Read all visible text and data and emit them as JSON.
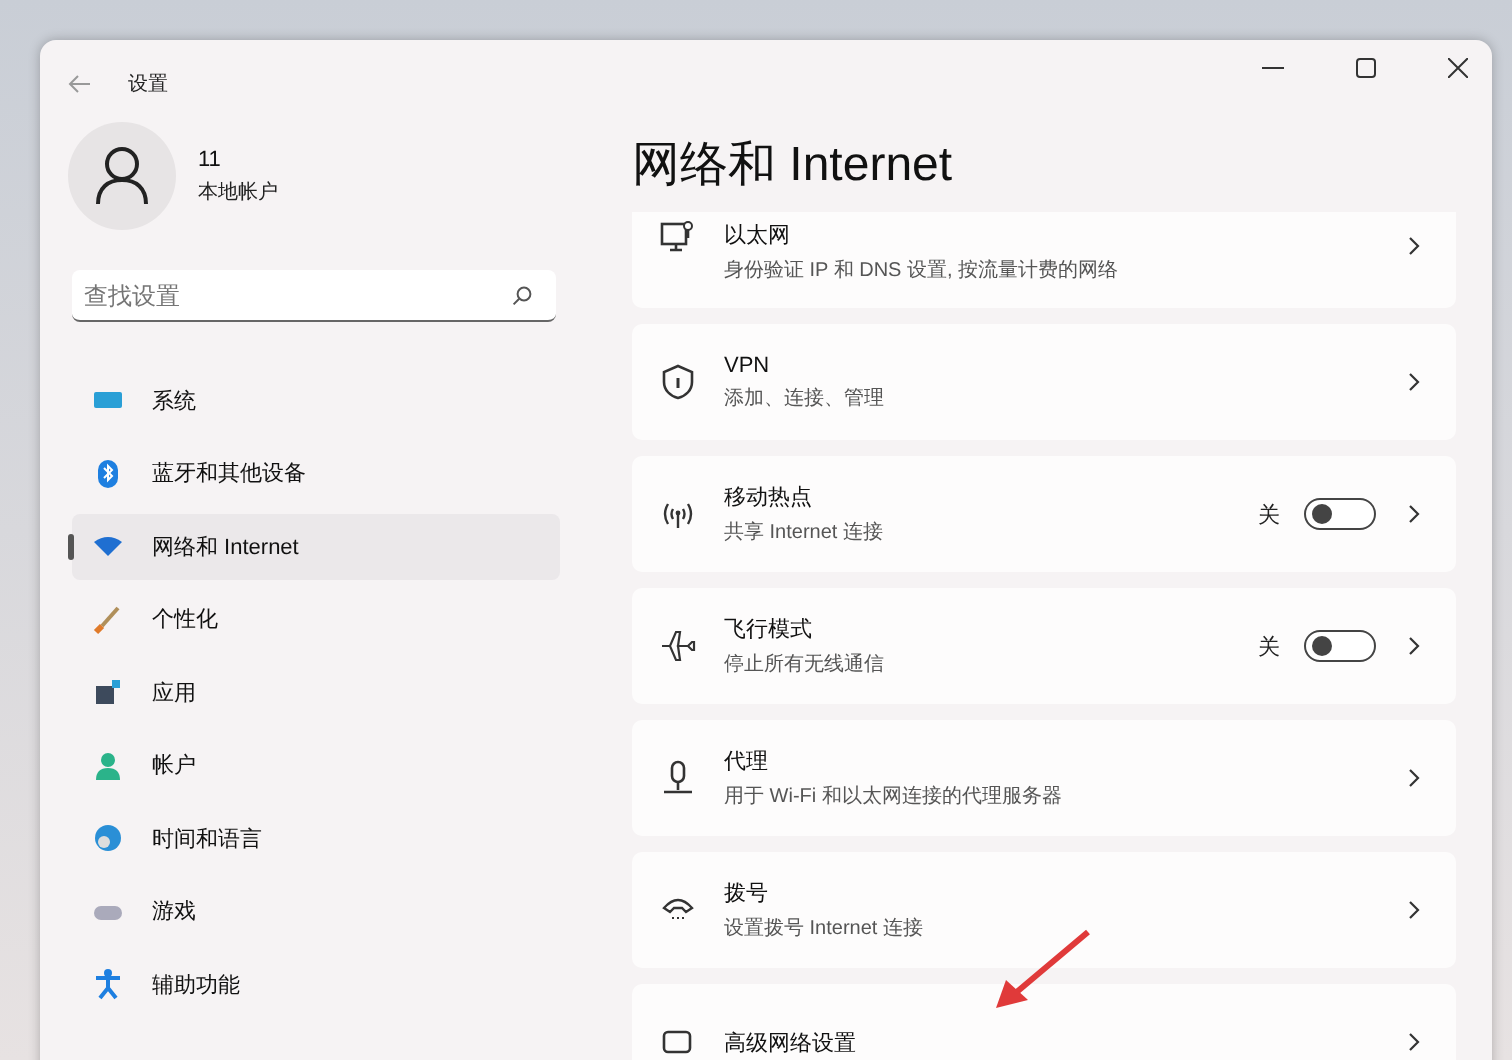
{
  "window": {
    "title": "设置"
  },
  "account": {
    "name": "11",
    "type": "本地帐户"
  },
  "search": {
    "placeholder": "查找设置"
  },
  "sidebar": {
    "items": [
      {
        "label": "系统",
        "selected": false
      },
      {
        "label": "蓝牙和其他设备",
        "selected": false
      },
      {
        "label": "网络和 Internet",
        "selected": true
      },
      {
        "label": "个性化",
        "selected": false
      },
      {
        "label": "应用",
        "selected": false
      },
      {
        "label": "帐户",
        "selected": false
      },
      {
        "label": "时间和语言",
        "selected": false
      },
      {
        "label": "游戏",
        "selected": false
      },
      {
        "label": "辅助功能",
        "selected": false
      }
    ]
  },
  "page": {
    "title": "网络和 Internet"
  },
  "cards": [
    {
      "kind": "link",
      "title": "以太网",
      "subtitle": "身份验证 IP 和 DNS 设置, 按流量计费的网络"
    },
    {
      "kind": "link",
      "title": "VPN",
      "subtitle": "添加、连接、管理"
    },
    {
      "kind": "toggle",
      "title": "移动热点",
      "subtitle": "共享 Internet 连接",
      "state": "关",
      "on": false
    },
    {
      "kind": "toggle",
      "title": "飞行模式",
      "subtitle": "停止所有无线通信",
      "state": "关",
      "on": false
    },
    {
      "kind": "link",
      "title": "代理",
      "subtitle": "用于 Wi-Fi 和以太网连接的代理服务器"
    },
    {
      "kind": "link",
      "title": "拨号",
      "subtitle": "设置拨号 Internet 连接"
    },
    {
      "kind": "link",
      "title": "高级网络设置"
    }
  ]
}
